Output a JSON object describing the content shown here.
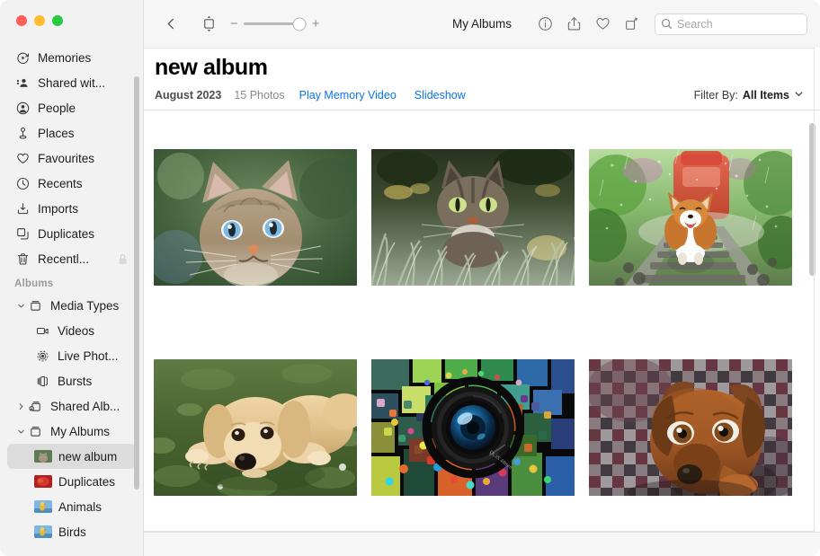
{
  "window": {
    "traffic_lights": [
      {
        "name": "close",
        "color": "#ff5f57"
      },
      {
        "name": "minimize",
        "color": "#febc2e"
      },
      {
        "name": "maximize",
        "color": "#28c840"
      }
    ]
  },
  "sidebar": {
    "top_items": [
      {
        "label": "Memories",
        "icon": "memories-icon"
      },
      {
        "label": "Shared wit...",
        "icon": "shared-with-you-icon"
      },
      {
        "label": "People",
        "icon": "people-icon"
      },
      {
        "label": "Places",
        "icon": "places-pin-icon"
      },
      {
        "label": "Favourites",
        "icon": "heart-icon"
      },
      {
        "label": "Recents",
        "icon": "clock-icon"
      },
      {
        "label": "Imports",
        "icon": "import-icon"
      },
      {
        "label": "Duplicates",
        "icon": "duplicates-icon"
      },
      {
        "label": "Recentl...",
        "icon": "trash-icon",
        "badge": "lock-icon"
      }
    ],
    "section_header": "Albums",
    "albums": [
      {
        "label": "Media Types",
        "icon": "album-box-icon",
        "expanded": true,
        "chevron": "chevron-down-icon",
        "level": 1
      },
      {
        "label": "Videos",
        "icon": "video-icon",
        "level": 2
      },
      {
        "label": "Live Phot...",
        "icon": "live-photo-icon",
        "level": 2
      },
      {
        "label": "Bursts",
        "icon": "bursts-icon",
        "level": 2
      },
      {
        "label": "Shared Alb...",
        "icon": "shared-album-icon",
        "expanded": false,
        "chevron": "chevron-right-icon",
        "level": 1
      },
      {
        "label": "My Albums",
        "icon": "album-box-icon",
        "expanded": true,
        "chevron": "chevron-down-icon",
        "level": 1
      },
      {
        "label": "new album",
        "icon": "album-thumbnail-cat",
        "level": 3,
        "selected": true
      },
      {
        "label": "Duplicates",
        "icon": "album-thumbnail-red",
        "level": 3
      },
      {
        "label": "Animals",
        "icon": "album-thumbnail-bird",
        "level": 3
      },
      {
        "label": "Birds",
        "icon": "album-thumbnail-bird",
        "level": 3
      }
    ]
  },
  "toolbar": {
    "back_icon": "chevron-left-icon",
    "aspect_icon": "aspect-ratio-icon",
    "zoom": {
      "minus": "−",
      "plus": "+",
      "value": 88
    },
    "title": "My Albums",
    "info_icon": "info-icon",
    "share_icon": "share-icon",
    "favourite_icon": "heart-icon",
    "rotate_icon": "rotate-icon",
    "search": {
      "icon": "search-icon",
      "placeholder": "Search",
      "value": ""
    }
  },
  "album": {
    "title": "new album",
    "date": "August 2023",
    "count": "15 Photos",
    "play_memory_video": "Play Memory Video",
    "slideshow": "Slideshow",
    "filter_label": "Filter By:",
    "filter_value": "All Items",
    "filter_chevron": "chevron-down-icon",
    "link_color": "#0b74e5"
  },
  "photos": [
    {
      "name": "photo-cat-blue-eyes",
      "alt": "Tabby cat with blue eyes on green bokeh background"
    },
    {
      "name": "photo-cat-in-grass",
      "alt": "Tabby cat crouched in frosty grass"
    },
    {
      "name": "photo-corgi-railway",
      "alt": "Corgi running on railway tracks in rain with red train"
    },
    {
      "name": "photo-golden-puppy",
      "alt": "Golden retriever puppy lying on grass"
    },
    {
      "name": "photo-camera-lens",
      "alt": "Camera lens surrounded by colourful mosaic"
    },
    {
      "name": "photo-brown-dog-blanket",
      "alt": "Brown dog resting on plaid blanket"
    }
  ]
}
